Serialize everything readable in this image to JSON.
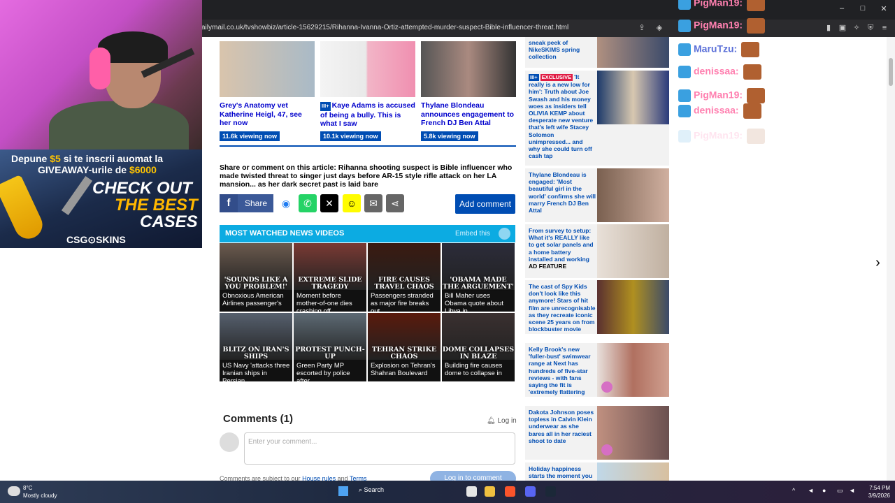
{
  "browser": {
    "url": "ailymail.co.uk/tvshowbiz/article-15629215/Rihanna-Ivanna-Ortiz-attempted-murder-suspect-Bible-influencer-threat.html",
    "window_controls": [
      "–",
      "□",
      "✕"
    ]
  },
  "overlay": {
    "promo_line1_a": "Depune ",
    "promo_line1_b": "$5",
    "promo_line1_c": " si te inscrii auomat la",
    "promo_line2_a": "GIVEAWAY-urile de ",
    "promo_line2_b": "$6000",
    "promo_big1": "CHECK OUT",
    "promo_big2": "THE BEST",
    "promo_big3": "CASES",
    "promo_brand": "CSG⊙SKINS",
    "chat": [
      {
        "name": "PigMan19:",
        "style": "pink"
      },
      {
        "name": "PigMan19:",
        "style": "pink"
      },
      {
        "name": "MaruTzu:",
        "style": "blue"
      },
      {
        "name": "denissaa:",
        "style": "pink"
      },
      {
        "name": "PigMan19:",
        "style": "pink"
      },
      {
        "name": "denissaa:",
        "style": "pink"
      },
      {
        "name": "PigMan19:",
        "style": "faded"
      }
    ]
  },
  "article": {
    "related": [
      {
        "caption": "Grey's Anatomy vet Katherine Heigl, 47, see her now",
        "viewing": "11.6k viewing now"
      },
      {
        "caption_badge": "III+",
        "caption": "Kaye Adams is accused of being a bully. This is what I saw",
        "viewing": "10.1k viewing now"
      },
      {
        "caption": "Thylane Blondeau announces engagement to French DJ Ben Attal",
        "viewing": "5.8k viewing now"
      }
    ],
    "share_title": "Share or comment on this article: Rihanna shooting suspect is Bible influencer who made twisted threat to singer just days before AR-15 style rifle attack on her LA mansion... as her dark secret past is laid bare",
    "share_label": "Share",
    "add_comment_label": "Add comment",
    "videos": {
      "header": "MOST WATCHED NEWS VIDEOS",
      "embed_label": "Embed this",
      "items": [
        {
          "overlay": "'SOUNDS LIKE A YOU PROBLEM!'",
          "caption": "Obnoxious American Airlines passenger's",
          "color": "#6b5a4e"
        },
        {
          "overlay": "EXTREME SLIDE TRAGEDY",
          "caption": "Moment before mother-of-one dies crashing off",
          "color": "#7a3a34"
        },
        {
          "overlay": "FIRE CAUSES TRAVEL CHAOS",
          "caption": "Passengers stranded as major fire breaks out",
          "color": "#3b1a10"
        },
        {
          "overlay": "'OBAMA MADE THE ARGUEMENT'",
          "caption": "Bill Maher uses Obama quote about Libya in",
          "color": "#2c2c3a"
        },
        {
          "overlay": "BLITZ ON IRAN'S SHIPS",
          "caption": "US Navy 'attacks three Iranian ships in Persian",
          "color": "#56606e"
        },
        {
          "overlay": "PROTEST PUNCH-UP",
          "caption": "Green Party MP escorted by police after",
          "color": "#5d6a74"
        },
        {
          "overlay": "TEHRAN STRIKE CHAOS",
          "caption": "Explosion on Tehran's Shahran Boulevard",
          "color": "#5a1a0c"
        },
        {
          "overlay": "DOME COLLAPSES IN BLAZE",
          "caption": "Building fire causes dome to collapse in",
          "color": "#3a3030"
        }
      ]
    },
    "comments": {
      "heading": "Comments (1)",
      "login_label": "Log in",
      "placeholder": "Enter your comment...",
      "rules_prefix": "Comments are subject to our ",
      "rules_link1": "House rules",
      "rules_mid": " and ",
      "rules_link2": "Terms",
      "login_button": "Log in to comment"
    }
  },
  "sidebar": {
    "cards": [
      {
        "text": "sneak peek of NikeSKIMS spring collection"
      },
      {
        "badge1": "III+",
        "badge2": "EXCLUSIVE",
        "text": "'It really is a new low for him': Truth about Joe Swash and his money woes as insiders tell OLIVIA KEMP about desperate new venture that's left wife Stacey Solomon unimpressed... and why she could turn off cash tap"
      },
      {
        "text": "Thylane Blondeau is engaged: 'Most beautiful girl in the world' confirms she will marry French DJ Ben Attal"
      },
      {
        "text": "From survey to setup: What it's REALLY like to get solar panels and a home battery installed and working",
        "ad": "AD FEATURE"
      },
      {
        "text": "The cast of Spy Kids don't look like this anymore! Stars of hit film are unrecognisable as they recreate iconic scene 25 years on from blockbuster movie"
      },
      {
        "text": "Kelly Brook's new 'fuller-bust' swimwear range at Next has hundreds of five-star reviews - with fans saying the fit is 'extremely flattering"
      },
      {
        "text": "Dakota Johnson poses topless in Calvin Klein underwear as she bares all in her raciest shoot to date"
      },
      {
        "text": "Holiday happiness starts the moment you"
      }
    ]
  },
  "taskbar": {
    "temp": "8°C",
    "weather": "Mostly cloudy",
    "search": "Search",
    "time": "7:54 PM",
    "date": "3/9/2026"
  }
}
